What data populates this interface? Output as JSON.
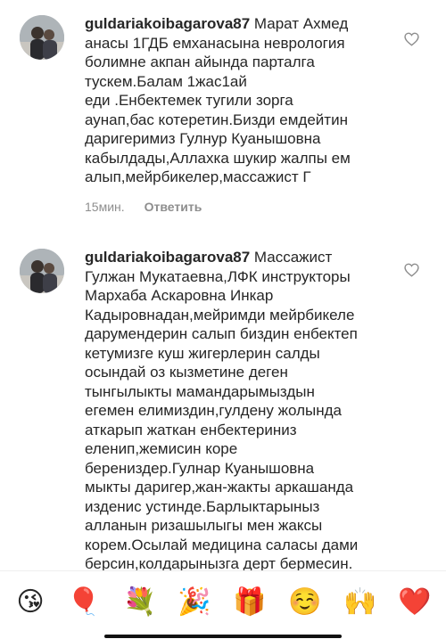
{
  "comments": [
    {
      "username": "guldariakoibagarova87",
      "text": " Марат Ахмед\nанасы 1ГДБ емханасына неврология\nболимне акпан айында парталга\nтускем.Балам 1жас1ай\nеди .Енбектемек тугили зорга\nаунап,бас котеретин.Бизди емдейтин\nдаригеримиз Гулнур Куанышовна\nкабылдады,Аллахка шукир жалпы ем\nалып,мейрбикелер,массажист Г",
      "time": "15мин.",
      "reply_label": "Ответить"
    },
    {
      "username": "guldariakoibagarova87",
      "text": " Массажист\nГулжан Мукатаевна,ЛФК инструкторы\nМархаба Аскаровна Инкар\nКадыровнадан,мейримди мейрбикеле\nдарумендерин салып биздин енбектеп\nкетумизге куш жигерлерин салды\nосындай оз кызметине деген\nтынгылыкты мамандарымыздын\nегемен елимиздин,гулдену жолында\nаткарып жаткан енбектериниз\nеленип,жемисин коре\nберениздер.Гулнар Куанышовна\nмыкты даригер,жан-жакты аркашанда\nизденис устинде.Барлыктарыныз\nалланын ризашылыгы мен жаксы\nкорем.Осылай медицина саласы дами\nберсин,колдарынызга дерт бермесин."
    }
  ],
  "emoji_bar": [
    "😘",
    "🎈",
    "💐",
    "🎉",
    "🎁",
    "☺️",
    "🙌",
    "❤️"
  ]
}
